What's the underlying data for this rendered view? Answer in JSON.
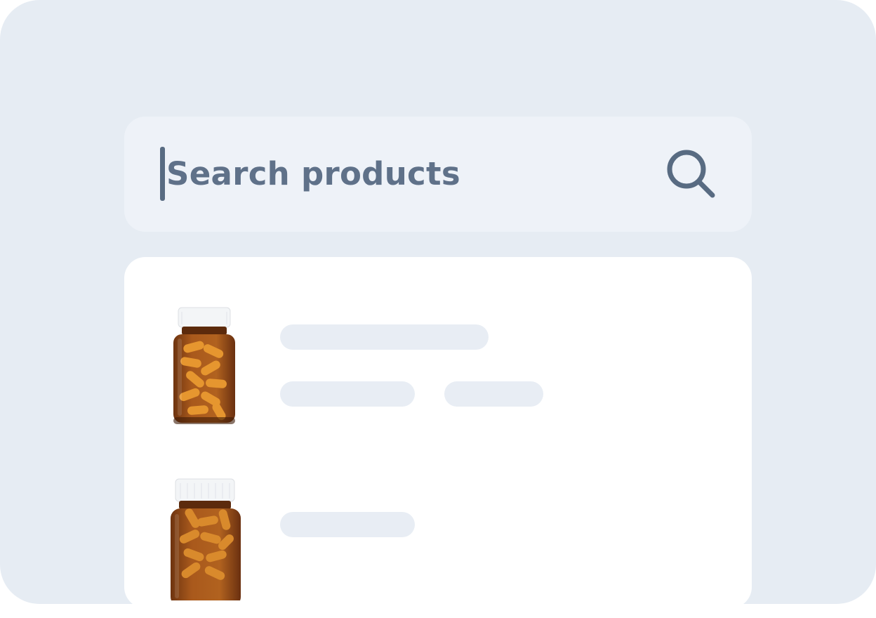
{
  "search": {
    "placeholder": "Search products",
    "icon": "search-icon"
  },
  "results": {
    "items": [
      {
        "thumbnail": "amber-pill-bottle-icon"
      },
      {
        "thumbnail": "amber-pill-bottle-icon"
      }
    ]
  },
  "colors": {
    "frame_background": "#e6ecf3",
    "search_background": "#eef2f8",
    "card_background": "#ffffff",
    "skeleton": "#e8edf4",
    "text": "#5f7189",
    "icon": "#586b82",
    "bottle_amber": "#a1541a",
    "capsule": "#e3932f",
    "cap": "#f4f6f8"
  }
}
